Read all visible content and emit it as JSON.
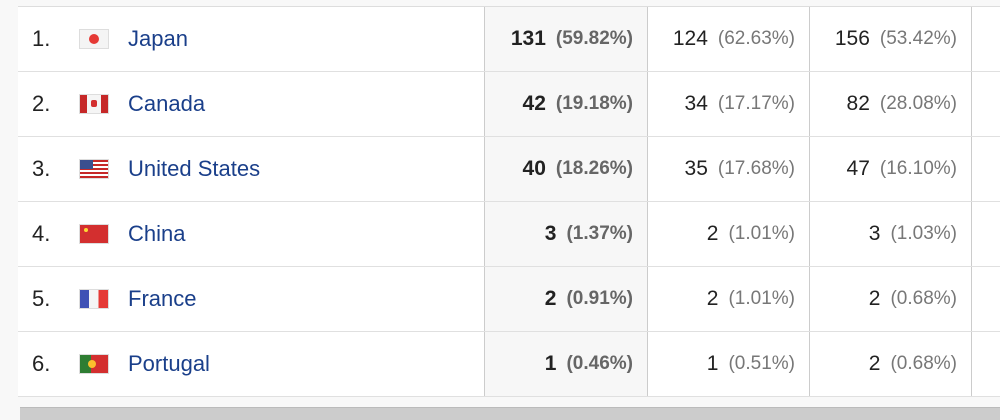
{
  "rows": [
    {
      "rank": "1.",
      "country": "Japan",
      "flag": "japan-flag",
      "m1": "131",
      "m1p": "(59.82%)",
      "m2": "124",
      "m2p": "(62.63%)",
      "m3": "156",
      "m3p": "(53.42%)"
    },
    {
      "rank": "2.",
      "country": "Canada",
      "flag": "canada-flag",
      "m1": "42",
      "m1p": "(19.18%)",
      "m2": "34",
      "m2p": "(17.17%)",
      "m3": "82",
      "m3p": "(28.08%)"
    },
    {
      "rank": "3.",
      "country": "United States",
      "flag": "us-flag",
      "m1": "40",
      "m1p": "(18.26%)",
      "m2": "35",
      "m2p": "(17.68%)",
      "m3": "47",
      "m3p": "(16.10%)"
    },
    {
      "rank": "4.",
      "country": "China",
      "flag": "china-flag",
      "m1": "3",
      "m1p": "(1.37%)",
      "m2": "2",
      "m2p": "(1.01%)",
      "m3": "3",
      "m3p": "(1.03%)"
    },
    {
      "rank": "5.",
      "country": "France",
      "flag": "france-flag",
      "m1": "2",
      "m1p": "(0.91%)",
      "m2": "2",
      "m2p": "(1.01%)",
      "m3": "2",
      "m3p": "(0.68%)"
    },
    {
      "rank": "6.",
      "country": "Portugal",
      "flag": "portugal-flag",
      "m1": "1",
      "m1p": "(0.46%)",
      "m2": "1",
      "m2p": "(0.51%)",
      "m3": "2",
      "m3p": "(0.68%)"
    }
  ]
}
